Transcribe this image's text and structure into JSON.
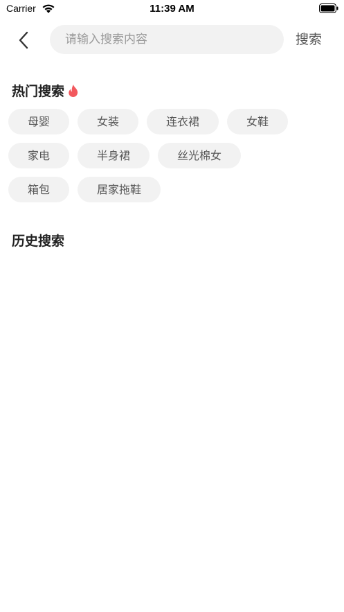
{
  "status_bar": {
    "carrier": "Carrier",
    "time": "11:39 AM"
  },
  "search": {
    "placeholder": "请输入搜索内容",
    "value": "",
    "button_label": "搜索"
  },
  "hot_search": {
    "title": "热门搜索",
    "rows": [
      [
        "母婴",
        "女装",
        "连衣裙",
        "女鞋"
      ],
      [
        "家电",
        "半身裙",
        "丝光棉女"
      ],
      [
        "箱包",
        "居家拖鞋"
      ]
    ]
  },
  "history_search": {
    "title": "历史搜索"
  },
  "colors": {
    "fire": "#f2585d",
    "tag_bg": "#f2f2f2"
  },
  "icons": {
    "back": "chevron-left-icon",
    "fire": "fire-icon",
    "wifi": "wifi-icon",
    "battery": "battery-icon"
  }
}
